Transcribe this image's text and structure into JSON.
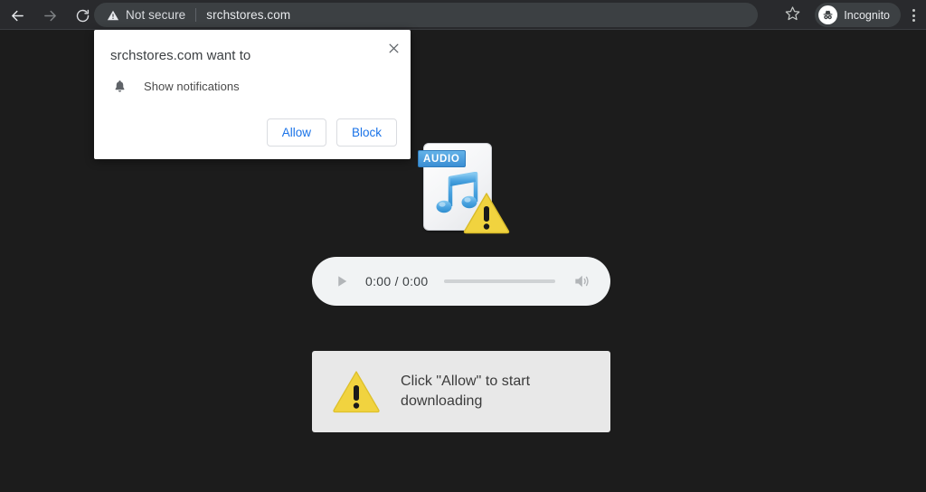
{
  "browser": {
    "nav": {
      "back_icon": "arrow-left-icon",
      "forward_icon": "arrow-right-icon",
      "reload_icon": "reload-icon"
    },
    "omnibox": {
      "security_icon": "warning-triangle-icon",
      "security_label": "Not secure",
      "url": "srchstores.com"
    },
    "star_icon": "star-icon",
    "profile": {
      "icon": "incognito-icon",
      "label": "Incognito"
    },
    "menu_icon": "three-dots-vertical-icon"
  },
  "permission_dialog": {
    "title": "srchstores.com want to",
    "request_icon": "bell-icon",
    "request_label": "Show notifications",
    "close_icon": "close-x-icon",
    "allow_label": "Allow",
    "block_label": "Block"
  },
  "page": {
    "file_icon": {
      "badge": "AUDIO",
      "doc_icon": "audio-file-document-icon",
      "note_icon": "music-note-icon",
      "warning_icon": "warning-triangle-icon"
    },
    "audio_player": {
      "play_icon": "play-icon",
      "time": "0:00 / 0:00",
      "seek_label": "audio-seek-bar",
      "volume_icon": "volume-icon"
    },
    "message": {
      "warning_icon": "warning-triangle-icon",
      "text": "Click \"Allow\" to start downloading"
    }
  },
  "colors": {
    "toolbar_bg": "#292a2d",
    "page_bg": "#1c1c1c",
    "omnibox_bg": "#3c4043",
    "accent_blue": "#1a73e8",
    "warning_yellow": "#f1d33f",
    "audio_blue": "#3b8fd4",
    "player_bg": "#f1f3f4",
    "msgbox_bg": "#e8e8e8"
  }
}
